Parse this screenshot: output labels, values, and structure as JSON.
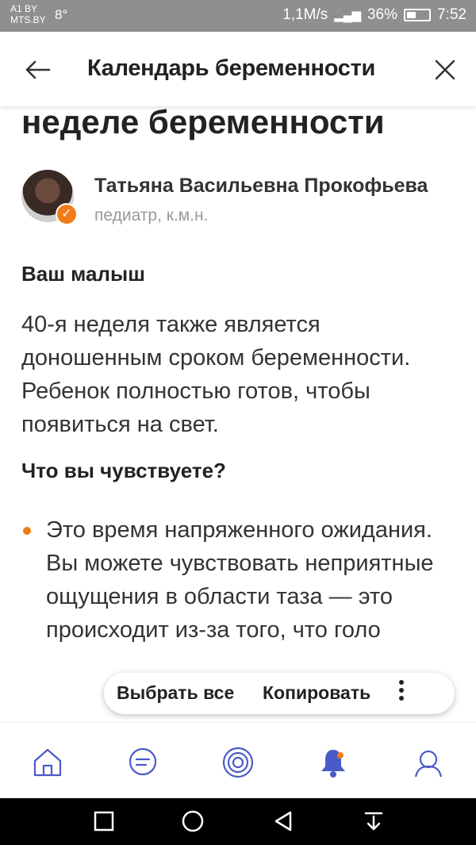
{
  "status_bar": {
    "carrier_line1": "A1 BY",
    "carrier_line2": "MTS.BY",
    "temperature": "8°",
    "network_speed": "1,1M/s",
    "battery_percent": "36%",
    "time": "7:52"
  },
  "header": {
    "title": "Календарь беременности",
    "back_icon": "arrow-left-icon",
    "close_icon": "close-icon"
  },
  "article": {
    "partial_heading": "неделе беременности",
    "author": {
      "name": "Татьяна Васильевна Прокофьева",
      "role": "педиатр, к.м.н."
    },
    "sections": [
      {
        "heading": "Ваш малыш",
        "text": "40-я неделя также является доношенным сроком беременности. Ребенок полностью готов, чтобы появиться на свет."
      },
      {
        "heading": "Что вы чувствуете?",
        "bullet": "Это время напряженного ожидания. Вы можете чувствовать неприятные ощущения в области таза — это происходит из-за того, что голо"
      }
    ]
  },
  "selection_toolbar": {
    "select_all": "Выбрать все",
    "copy": "Копировать"
  },
  "tab_bar": {
    "tabs": [
      "home-icon",
      "chat-icon",
      "target-icon",
      "bell-icon",
      "profile-icon"
    ]
  },
  "colors": {
    "accent": "#f07b17",
    "status_bar": "#8f8f8f",
    "navbar": "#000000"
  }
}
